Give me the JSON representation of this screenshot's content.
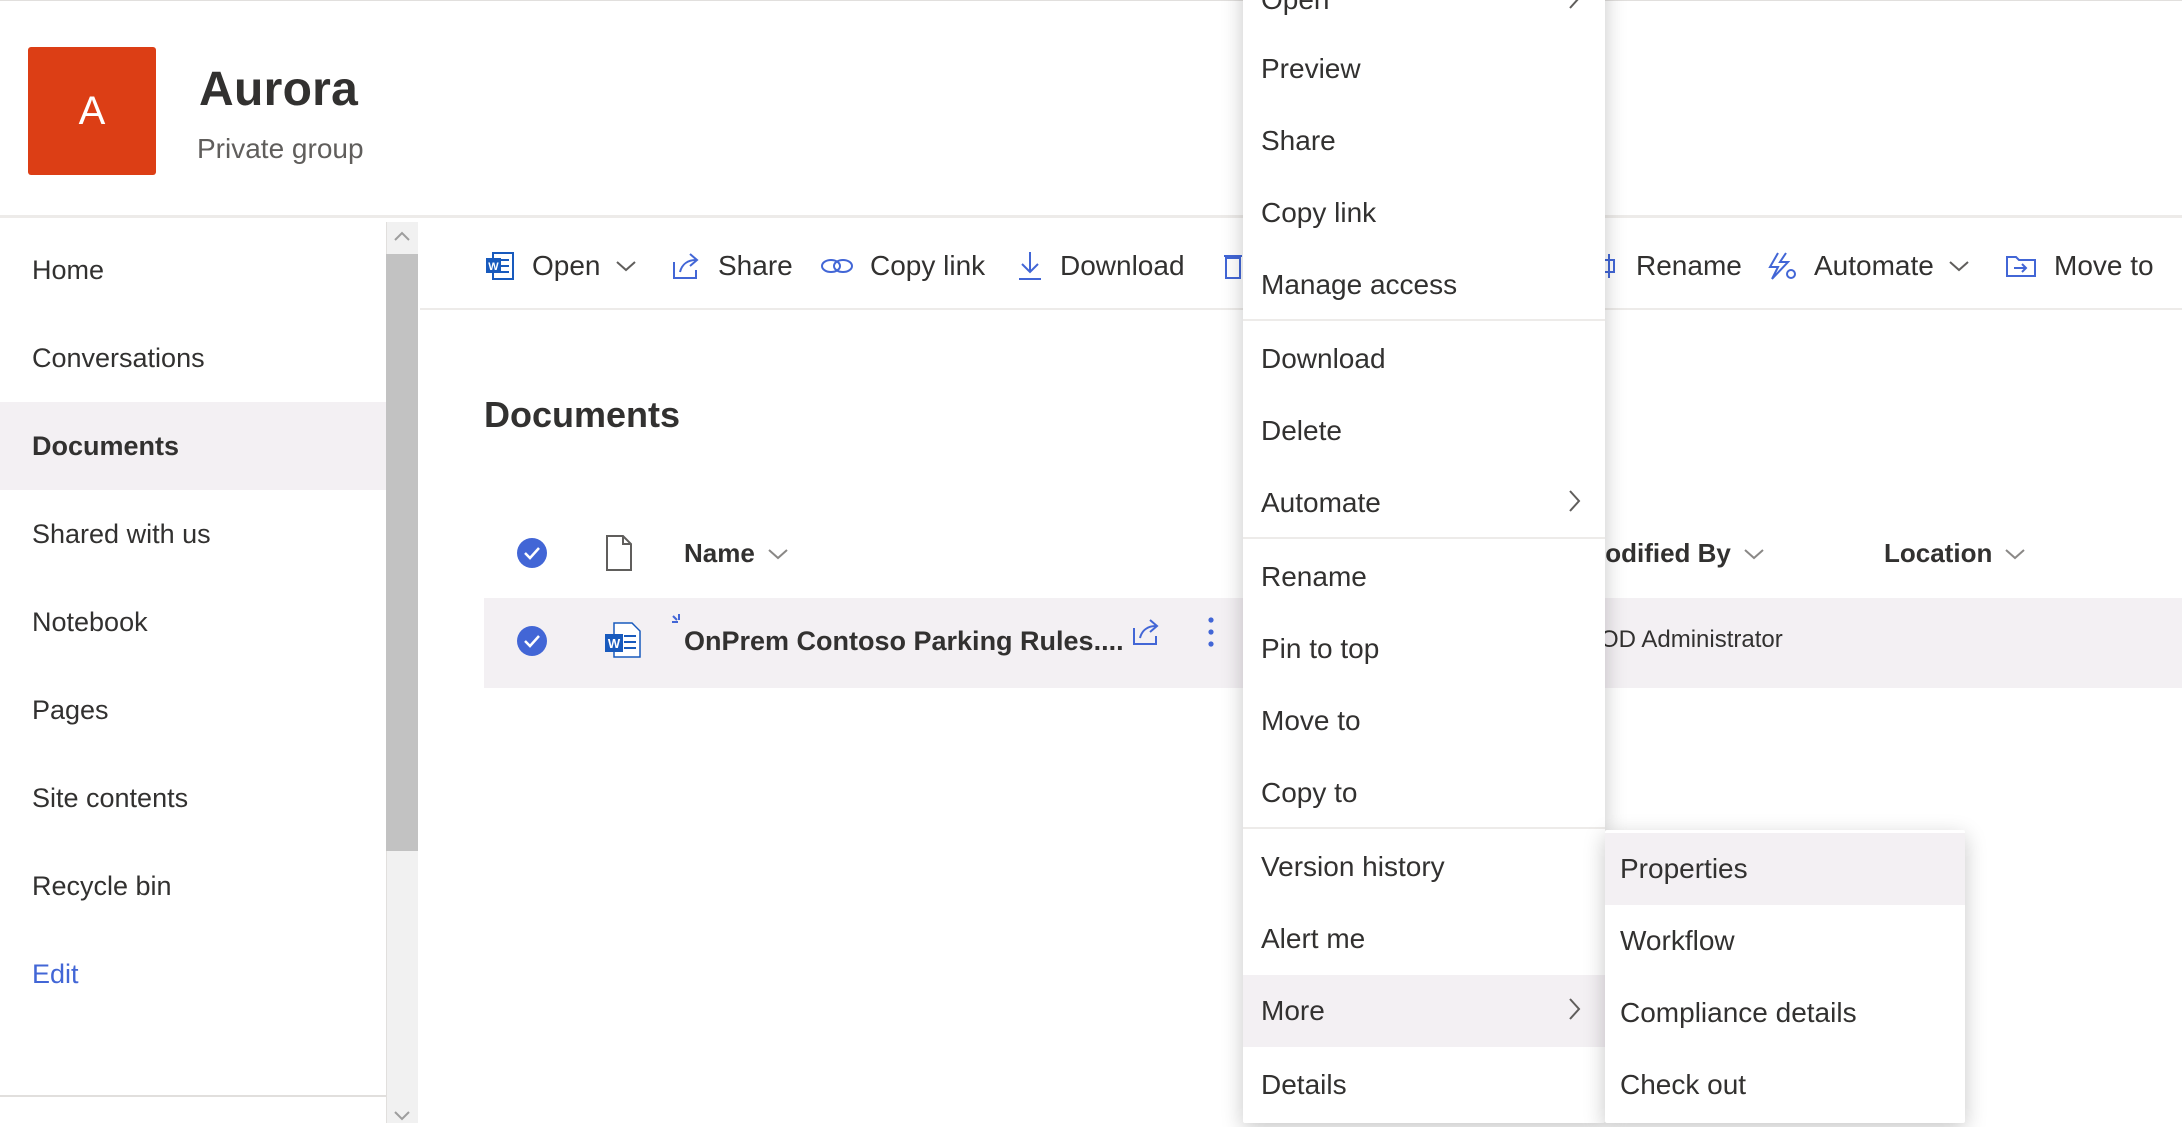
{
  "site": {
    "logo_letter": "A",
    "title": "Aurora",
    "subtitle": "Private group"
  },
  "colors": {
    "logo_bg": "#dc3e15",
    "accent": "#4266d6",
    "word_blue": "#185abd"
  },
  "nav": {
    "items": [
      {
        "label": "Home"
      },
      {
        "label": "Conversations"
      },
      {
        "label": "Documents",
        "selected": true
      },
      {
        "label": "Shared with us"
      },
      {
        "label": "Notebook"
      },
      {
        "label": "Pages"
      },
      {
        "label": "Site contents"
      },
      {
        "label": "Recycle bin"
      }
    ],
    "edit_label": "Edit"
  },
  "commands": {
    "open": "Open",
    "share": "Share",
    "copy_link": "Copy link",
    "download": "Download",
    "rename": "Rename",
    "automate": "Automate",
    "move_to": "Move to"
  },
  "library": {
    "title": "Documents",
    "columns": {
      "name": "Name",
      "modified_by": "lodified By",
      "location": "Location"
    },
    "rows": [
      {
        "name": "OnPrem Contoso Parking Rules....",
        "modified_by": "OD Administrator",
        "selected": true
      }
    ]
  },
  "context_menu": {
    "items": [
      {
        "label": "Open",
        "has_submenu": true
      },
      {
        "label": "Preview"
      },
      {
        "label": "Share"
      },
      {
        "label": "Copy link"
      },
      {
        "label": "Manage access"
      },
      {
        "label": "Download"
      },
      {
        "label": "Delete"
      },
      {
        "label": "Automate",
        "has_submenu": true
      },
      {
        "label": "Rename"
      },
      {
        "label": "Pin to top"
      },
      {
        "label": "Move to"
      },
      {
        "label": "Copy to"
      },
      {
        "label": "Version history"
      },
      {
        "label": "Alert me"
      },
      {
        "label": "More",
        "has_submenu": true,
        "highlighted": true
      },
      {
        "label": "Details"
      }
    ]
  },
  "submenu": {
    "items": [
      {
        "label": "Properties",
        "highlighted": true
      },
      {
        "label": "Workflow"
      },
      {
        "label": "Compliance details"
      },
      {
        "label": "Check out"
      }
    ]
  }
}
